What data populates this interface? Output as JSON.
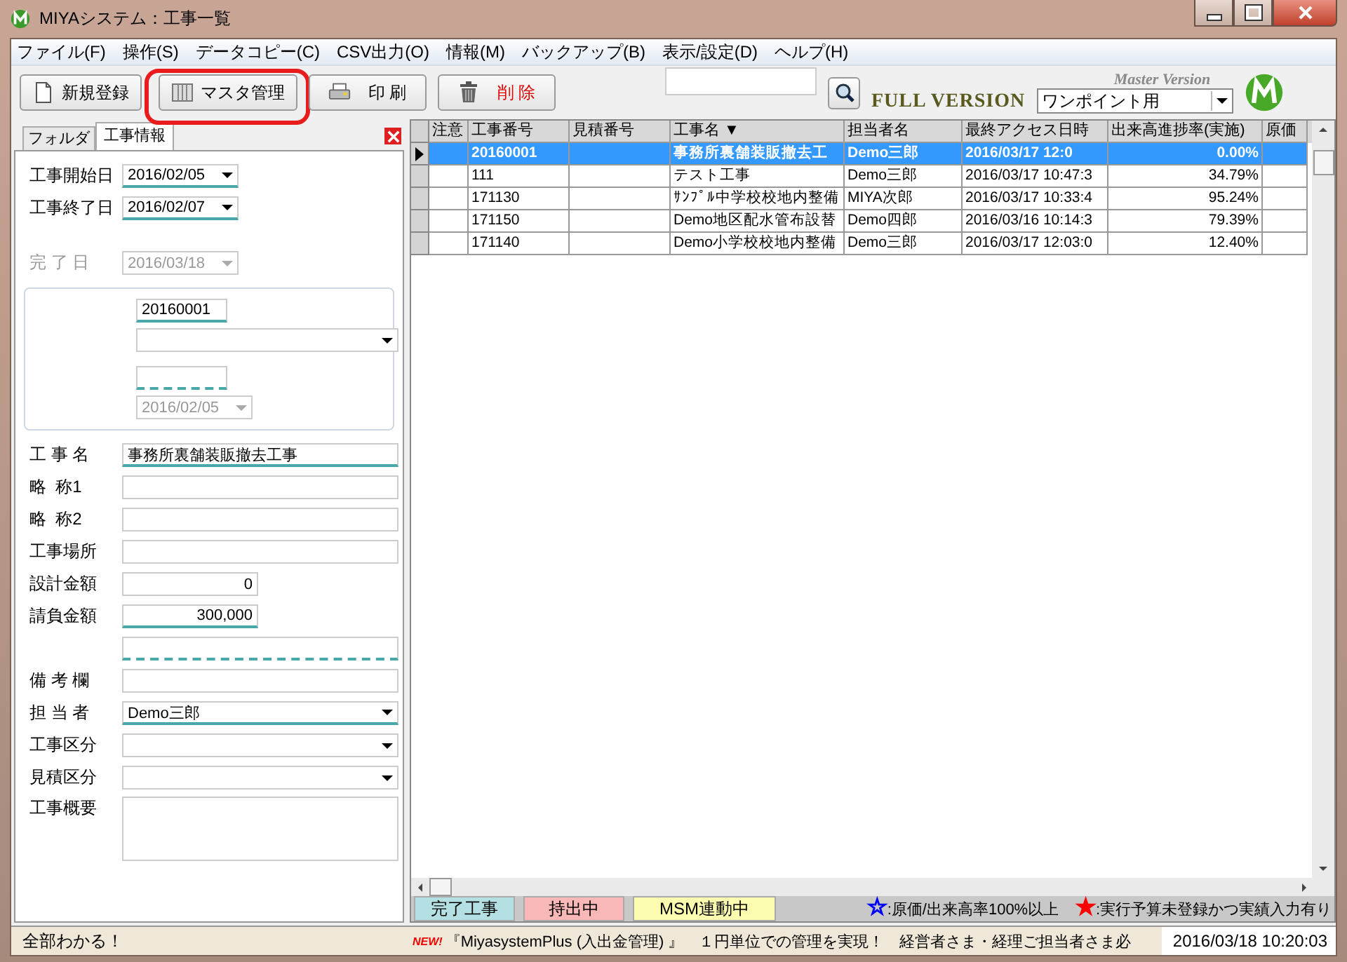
{
  "window": {
    "title": "MIYAシステム：工事一覧"
  },
  "menu": [
    "ファイル(F)",
    "操作(S)",
    "データコピー(C)",
    "CSV出力(O)",
    "情報(M)",
    "バックアップ(B)",
    "表示/設定(D)",
    "ヘルプ(H)"
  ],
  "toolbar": {
    "buttons": [
      {
        "kind": "new",
        "label": "新規登録",
        "highlighted": false
      },
      {
        "kind": "master",
        "label": "マスタ管理",
        "highlighted": true
      },
      {
        "kind": "print",
        "label": "印 刷",
        "highlighted": false
      },
      {
        "kind": "delete",
        "label": "削 除",
        "highlighted": false
      }
    ],
    "edition": "FULL VERSION",
    "sub_edition": "Master Version",
    "mode_select": "ワンポイント用"
  },
  "left_panel": {
    "tabs": [
      {
        "label": "フォルダ",
        "selected": false
      },
      {
        "label": "工事情報",
        "selected": true
      }
    ],
    "dates": [
      {
        "label": "工事開始日",
        "kind": "date",
        "value": "2016/02/05",
        "disabled": false,
        "underline": true
      },
      {
        "label": "工事終了日",
        "kind": "date",
        "value": "2016/02/07",
        "disabled": false,
        "underline": true
      }
    ],
    "completion": {
      "label": "完 了 日",
      "kind": "date",
      "value": "2016/03/18",
      "disabled": true
    },
    "group": [
      {
        "kind": "code",
        "value": "20160001",
        "underline": true
      },
      {
        "kind": "select"
      },
      {
        "kind": "code",
        "underline_dashed": true
      },
      {
        "kind": "date",
        "value": "2016/02/05",
        "disabled": true
      }
    ],
    "details": [
      {
        "label": "工 事 名",
        "kind": "text",
        "value": "事務所裏舗装販撤去工事",
        "underline": true
      },
      {
        "label": "略  称1",
        "kind": "text"
      },
      {
        "label": "略  称2",
        "kind": "text"
      },
      {
        "label": "工事場所",
        "kind": "text"
      },
      {
        "label": "設計金額",
        "kind": "amount",
        "value": "0"
      },
      {
        "label": "請負金額",
        "kind": "amount",
        "value": "300,000",
        "underline": true
      },
      {
        "kind": "text",
        "underline_dashed": true
      },
      {
        "label": "備 考 欄",
        "kind": "text"
      },
      {
        "label": "担 当 者",
        "kind": "select",
        "value": "Demo三郎",
        "underline": true
      },
      {
        "label": "工事区分",
        "kind": "select"
      },
      {
        "label": "見積区分",
        "kind": "select"
      },
      {
        "label": "工事概要",
        "kind": "memo"
      }
    ]
  },
  "table": {
    "columns": [
      "注意",
      "工事番号",
      "見積番号",
      "工事名 ▼",
      "担当者名",
      "最終アクセス日時",
      "出来高進捗率(実施)",
      "原価"
    ],
    "rows": [
      {
        "selected": true,
        "cells": [
          "",
          "20160001",
          "",
          "事務所裏舗装販撤去工",
          "Demo三郎",
          "2016/03/17 12:0",
          "0.00%",
          ""
        ]
      },
      {
        "selected": false,
        "cells": [
          "",
          "111",
          "",
          "テスト工事",
          "Demo三郎",
          "2016/03/17 10:47:3",
          "34.79%",
          ""
        ]
      },
      {
        "selected": false,
        "cells": [
          "",
          "171130",
          "",
          "ｻﾝﾌﾟﾙ中学校校地内整備",
          "MIYA次郎",
          "2016/03/17 10:33:4",
          "95.24%",
          ""
        ]
      },
      {
        "selected": false,
        "cells": [
          "",
          "171150",
          "",
          "Demo地区配水管布設替",
          "Demo四郎",
          "2016/03/16 10:14:3",
          "79.39%",
          ""
        ]
      },
      {
        "selected": false,
        "cells": [
          "",
          "171140",
          "",
          "Demo小学校校地内整備",
          "Demo三郎",
          "2016/03/17 12:03:0",
          "12.40%",
          ""
        ]
      }
    ]
  },
  "legend": {
    "tags": [
      {
        "label": "完了工事",
        "color": "#b4e0e4"
      },
      {
        "label": "持出中",
        "color": "#f8b8b8"
      },
      {
        "label": "MSM連動中",
        "color": "#fcfcb0"
      }
    ],
    "notes": [
      {
        "star": "☆",
        "color": "#0000ff",
        "text": ":原価/出来高率100%以上"
      },
      {
        "star": "★",
        "color": "#ff0000",
        "text": ":実行予算未登録かつ実績入力有り"
      }
    ]
  },
  "status_bar": {
    "message": "全部わかる！",
    "badge": "NEW!",
    "ticker": "『MiyasystemPlus (入出金管理) 』　１円単位での管理を実現！　経営者さま・経理ご担当者さま必",
    "clock": "2016/03/18 10:20:03"
  }
}
